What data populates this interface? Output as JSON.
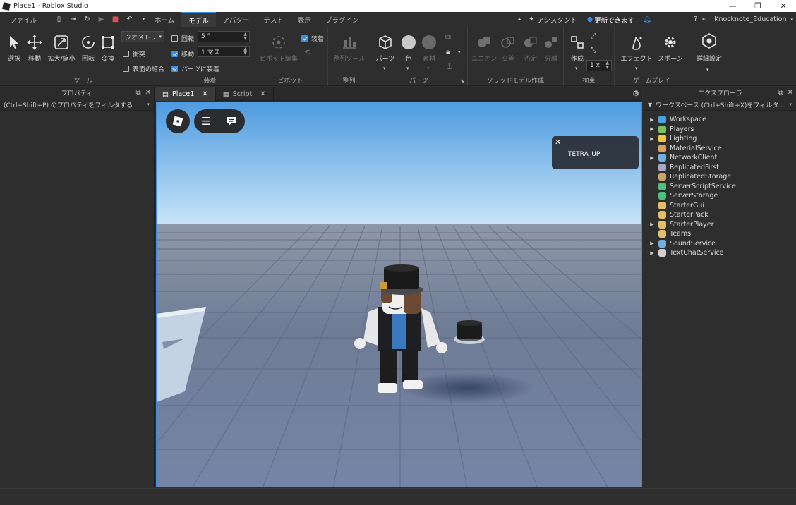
{
  "window": {
    "title": "Place1 - Roblox Studio"
  },
  "menu": {
    "items": [
      "ファイル",
      "ホーム",
      "モデル",
      "アバター",
      "テスト",
      "表示",
      "プラグイン"
    ],
    "active_index": 2,
    "assistant": "アシスタント",
    "update": "更新できます",
    "user": "Knocknote_Education"
  },
  "ribbon": {
    "tools_group": {
      "label": "ツール",
      "select": "選択",
      "move": "移動",
      "scale": "拡大/縮小",
      "rotate": "回転",
      "transform": "変換",
      "geometry": "ジオメトリ",
      "collisions": "衝突",
      "join_surfaces": "表面の結合"
    },
    "snap_group": {
      "label": "装着",
      "rotate": "回転",
      "rotate_value": "5 °",
      "move": "移動",
      "move_value": "1 マス",
      "join_parts": "パーツに装着"
    },
    "pivot_group": {
      "label": "ピボット",
      "edit_pivot": "ピボット編集",
      "attach": "装着"
    },
    "align_group": {
      "label": "整列",
      "align_tool": "整列ツール"
    },
    "parts_group": {
      "label": "パーツ",
      "part": "パーツ",
      "color": "色",
      "material": "素材"
    },
    "solid_group": {
      "label": "ソリッドモデル作成",
      "union": "ユニオン",
      "intersect": "交差",
      "negate": "否定",
      "separate": "分離"
    },
    "constraint_group": {
      "label": "拘束",
      "create": "作成",
      "scale_value": "1 x"
    },
    "gameplay_group": {
      "label": "ゲームプレイ",
      "effects": "エフェクト",
      "spawn": "スポーン"
    },
    "advanced_group": {
      "label": "詳細設定",
      "advanced": "詳細設定"
    }
  },
  "properties": {
    "title": "プロパティ",
    "filter": "(Ctrl+Shift+P) のプロパティをフィルタする"
  },
  "tabs": [
    {
      "label": "Place1"
    },
    {
      "label": "Script"
    }
  ],
  "viewport": {
    "notification": "TETRA_UP"
  },
  "explorer": {
    "title": "エクスプローラ",
    "filter": "ワークスペース (Ctrl+Shift+X)をフィルタ...",
    "items": [
      {
        "label": "Workspace",
        "expandable": true,
        "color": "#4aa3df"
      },
      {
        "label": "Players",
        "expandable": true,
        "color": "#7fc15a"
      },
      {
        "label": "Lighting",
        "expandable": true,
        "color": "#f2c744"
      },
      {
        "label": "MaterialService",
        "expandable": false,
        "color": "#d9a55b"
      },
      {
        "label": "NetworkClient",
        "expandable": true,
        "color": "#6fb0e0"
      },
      {
        "label": "ReplicatedFirst",
        "expandable": false,
        "color": "#a8a8c8"
      },
      {
        "label": "ReplicatedStorage",
        "expandable": false,
        "color": "#c9a56a"
      },
      {
        "label": "ServerScriptService",
        "expandable": false,
        "color": "#49c27a"
      },
      {
        "label": "ServerStorage",
        "expandable": false,
        "color": "#49c27a"
      },
      {
        "label": "StarterGui",
        "expandable": false,
        "color": "#e0c06a"
      },
      {
        "label": "StarterPack",
        "expandable": false,
        "color": "#e0c06a"
      },
      {
        "label": "StarterPlayer",
        "expandable": true,
        "color": "#e0c06a"
      },
      {
        "label": "Teams",
        "expandable": false,
        "color": "#e0c06a"
      },
      {
        "label": "SoundService",
        "expandable": true,
        "color": "#6fb0e0"
      },
      {
        "label": "TextChatService",
        "expandable": true,
        "color": "#d0d0d0"
      }
    ]
  }
}
